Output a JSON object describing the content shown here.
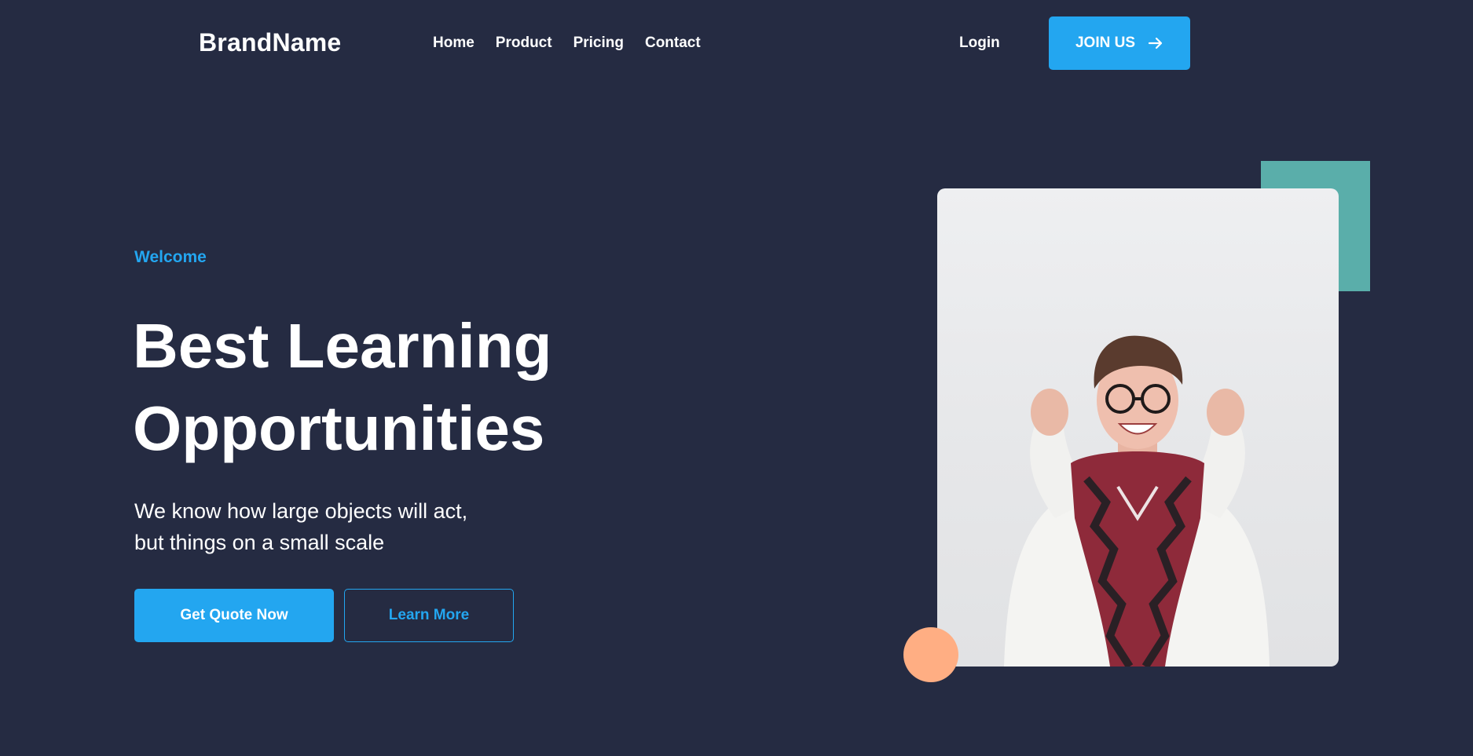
{
  "header": {
    "brand": "BrandName",
    "nav": [
      "Home",
      "Product",
      "Pricing",
      "Contact"
    ],
    "login_label": "Login",
    "join_label": "JOIN US",
    "join_icon": "arrow-right-icon"
  },
  "hero": {
    "eyebrow": "Welcome",
    "title_lines": [
      "Best Learning",
      "Opportunities"
    ],
    "subtitle_lines": [
      "We know how large objects will act,",
      "but things on a small scale"
    ],
    "primary_button": "Get Quote Now",
    "secondary_button": "Learn More",
    "image": "photo of a smiling woman with glasses and a red patterned scarf cheering with raised fists"
  },
  "colors": {
    "background": "#252B42",
    "accent_blue": "#23A6F0",
    "teal": "#5AAEAA",
    "peach": "#FFAE83",
    "text": "#FFFFFF"
  }
}
